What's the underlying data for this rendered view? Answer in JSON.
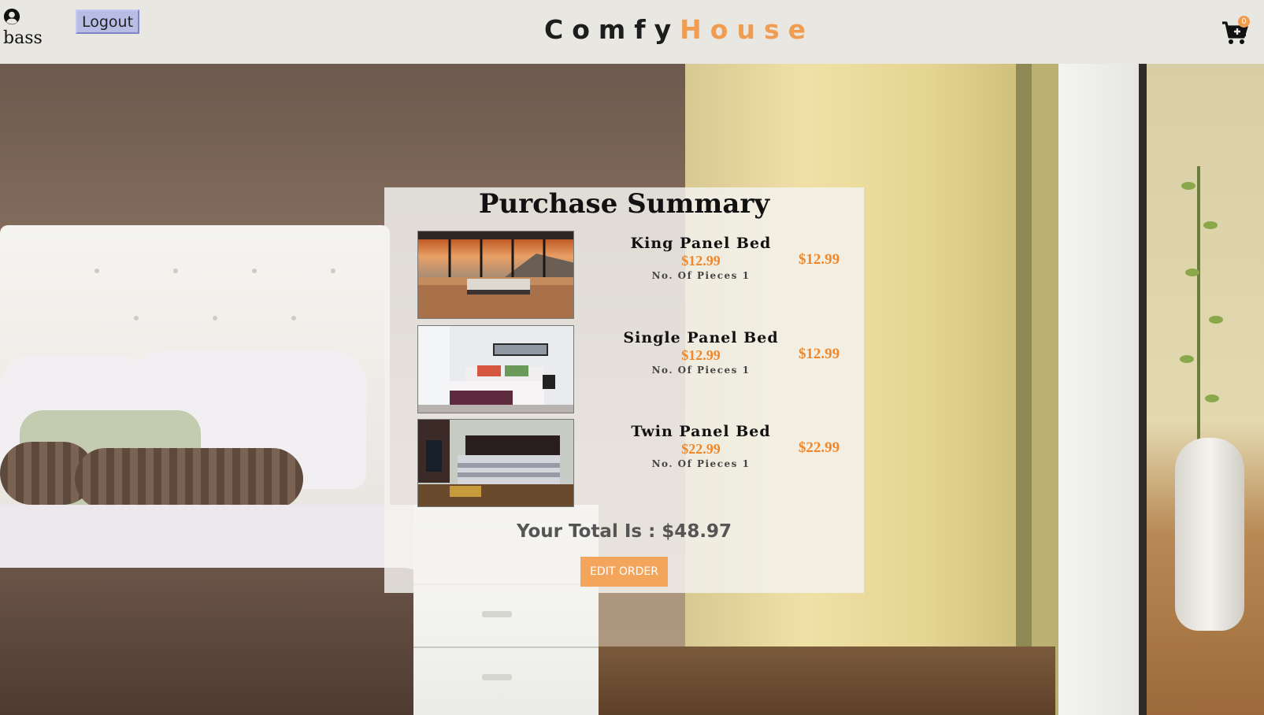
{
  "header": {
    "username": "bass",
    "logout_label": "Logout",
    "brand_part1": "Comfy",
    "brand_part2": "House",
    "cart_count": "0",
    "user_icon": "user-circle-icon",
    "cart_icon": "cart-plus-icon"
  },
  "summary": {
    "title": "Purchase Summary",
    "items": [
      {
        "name": "King Panel Bed",
        "price": "$12.99",
        "qty_label": "No. Of Pieces 1",
        "subtotal": "$12.99"
      },
      {
        "name": "Single Panel Bed",
        "price": "$12.99",
        "qty_label": "No. Of Pieces 1",
        "subtotal": "$12.99"
      },
      {
        "name": "Twin Panel Bed",
        "price": "$22.99",
        "qty_label": "No. Of Pieces 1",
        "subtotal": "$22.99"
      }
    ],
    "total_label": "Your Total Is : $48.97",
    "edit_button": "EDIT ORDER"
  },
  "colors": {
    "accent": "#f09d51",
    "price": "#f0872a",
    "navbar": "#e9e7e2"
  }
}
